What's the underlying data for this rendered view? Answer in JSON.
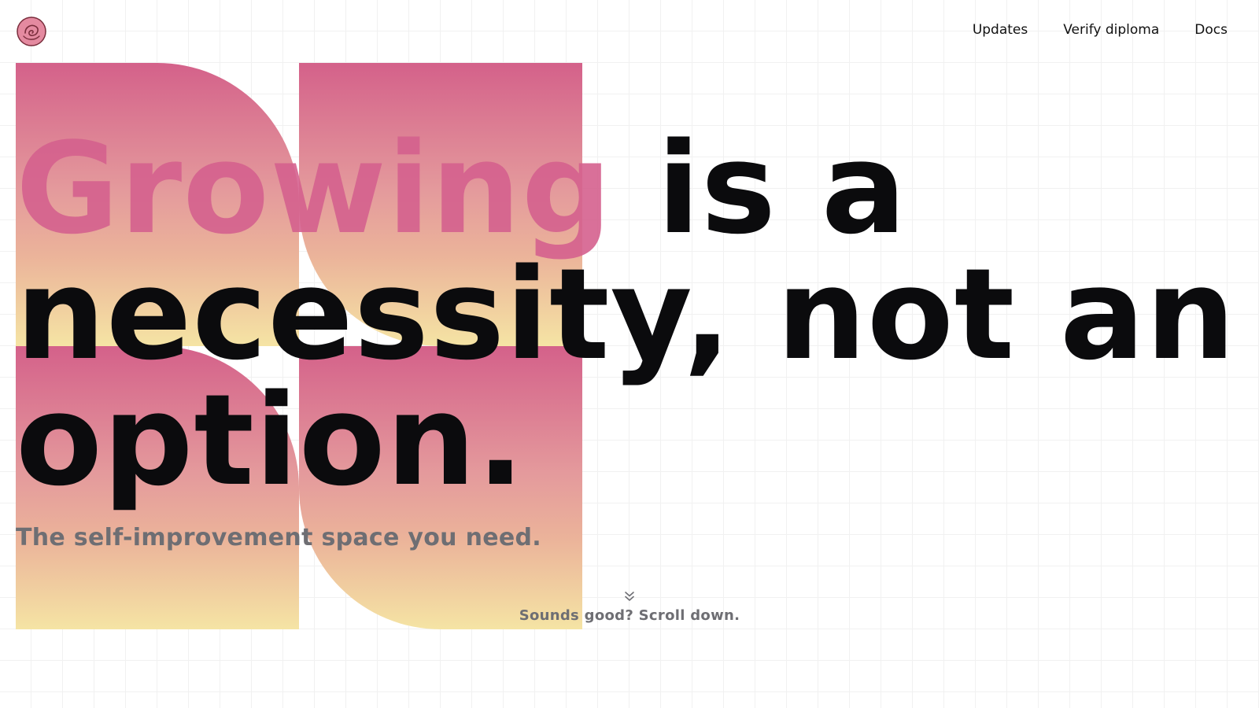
{
  "brand": {
    "logo_icon": "rose-icon",
    "accent_color": "#d5618e",
    "gradient_top": "#d4618a",
    "gradient_bottom": "#f5e4a4"
  },
  "nav": {
    "items": [
      {
        "label": "Updates"
      },
      {
        "label": "Verify diploma"
      },
      {
        "label": "Docs"
      }
    ]
  },
  "hero": {
    "headline_accent": "Growing",
    "headline_line1_rest": "is a",
    "headline_line2": "necessity, not an",
    "headline_line3": "option.",
    "subtitle": "The self-improvement space you need."
  },
  "scroll_hint": {
    "icon": "double-chevron-down-icon",
    "label": "Sounds good? Scroll down."
  }
}
